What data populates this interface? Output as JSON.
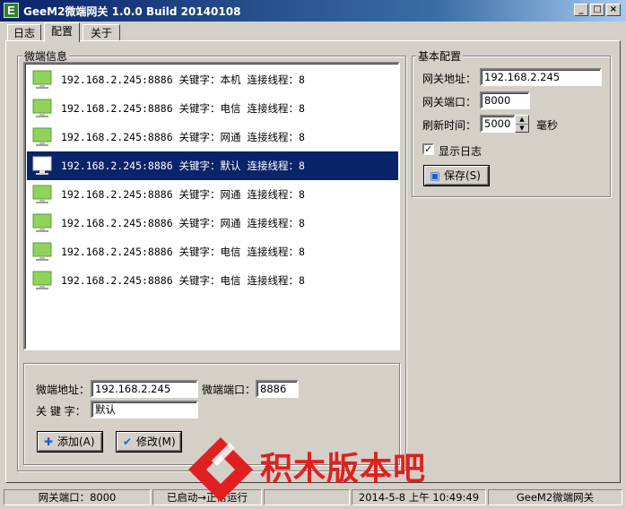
{
  "window": {
    "title": "GeeM2微端网关 1.0.0 Build 20140108",
    "icon_letter": "E",
    "controls": [
      "_",
      "□",
      "×"
    ]
  },
  "tabs": [
    {
      "label": "日志",
      "active": false
    },
    {
      "label": "配置",
      "active": true
    },
    {
      "label": "关于",
      "active": false
    }
  ],
  "micro_info": {
    "legend": "微端信息",
    "rows": [
      {
        "text": "192.168.2.245:8886 关键字：本机 连接线程：8",
        "selected": false
      },
      {
        "text": "192.168.2.245:8886 关键字：电信 连接线程：8",
        "selected": false
      },
      {
        "text": "192.168.2.245:8886 关键字：网通 连接线程：8",
        "selected": false
      },
      {
        "text": "192.168.2.245:8886 关键字：默认 连接线程：8",
        "selected": true
      },
      {
        "text": "192.168.2.245:8886 关键字：网通 连接线程：8",
        "selected": false
      },
      {
        "text": "192.168.2.245:8886 关键字：网通 连接线程：8",
        "selected": false
      },
      {
        "text": "192.168.2.245:8886 关键字：电信 连接线程：8",
        "selected": false
      },
      {
        "text": "192.168.2.245:8886 关键字：电信 连接线程：8",
        "selected": false
      }
    ]
  },
  "edit_form": {
    "address_label": "微端地址：",
    "address_value": "192.168.2.245",
    "port_label": "微端端口：",
    "port_value": "8886",
    "keyword_label": "关 键 字：",
    "keyword_value": "默认",
    "add_button": "添加(A)",
    "modify_button": "修改(M)"
  },
  "basic_config": {
    "legend": "基本配置",
    "gateway_address_label": "网关地址：",
    "gateway_address_value": "192.168.2.245",
    "gateway_port_label": "网关端口：",
    "gateway_port_value": "8000",
    "refresh_label": "刷新时间：",
    "refresh_value": "5000",
    "refresh_unit": "毫秒",
    "show_log_label": "显示日志",
    "show_log_checked": true,
    "save_button": "保存(S)"
  },
  "status_bar": {
    "gateway_port": "网关端口：8000",
    "state": "已启动→正常运行",
    "empty": "",
    "datetime": "2014-5-8  上午  10:49:49",
    "app_name": "GeeM2微端网关"
  },
  "watermark": {
    "text": "积木版本吧"
  },
  "colors": {
    "title_bar": "#0a246a",
    "selection": "#0a246a",
    "monitor": "#8fd35a",
    "watermark": "#e02020"
  }
}
